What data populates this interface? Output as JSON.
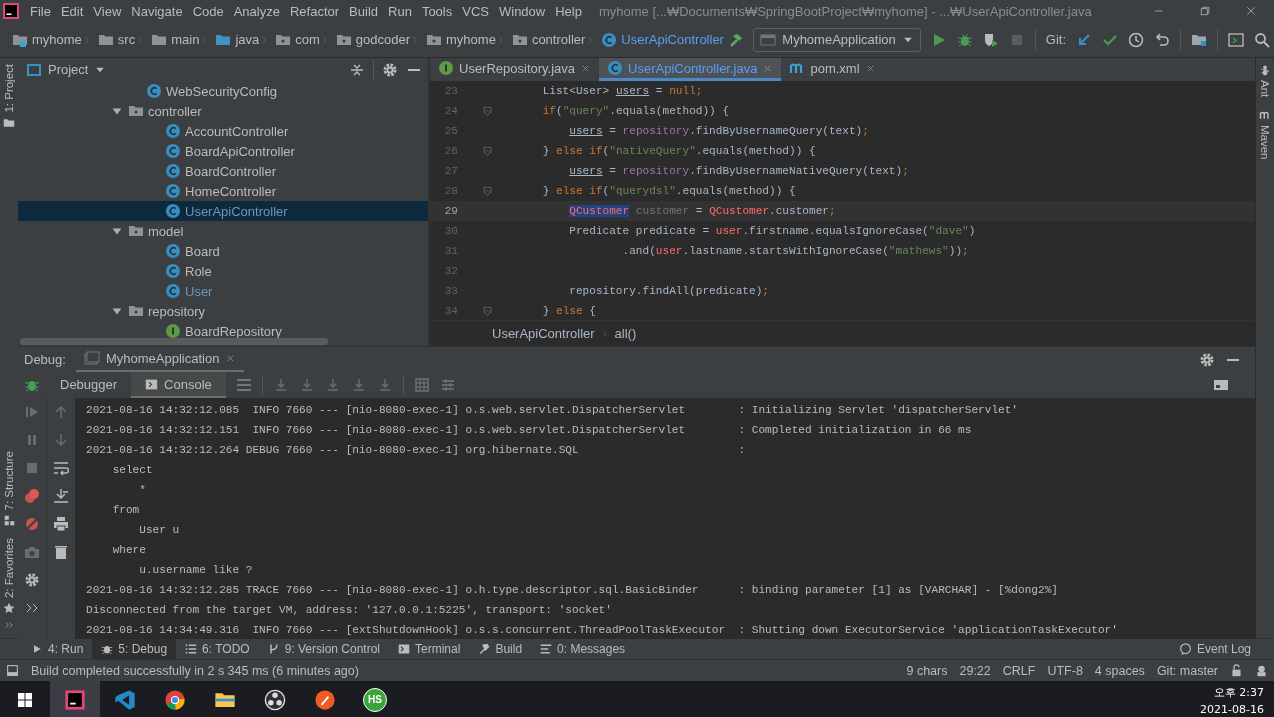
{
  "window": {
    "title": "myhome [...₩Documents₩SpringBootProject₩myhome] - ...₩UserApiController.java"
  },
  "menu": [
    "File",
    "Edit",
    "View",
    "Navigate",
    "Code",
    "Analyze",
    "Refactor",
    "Build",
    "Run",
    "Tools",
    "VCS",
    "Window",
    "Help"
  ],
  "breadcrumb": [
    {
      "label": "myhome",
      "kind": "module"
    },
    {
      "label": "src",
      "kind": "folder"
    },
    {
      "label": "main",
      "kind": "folder"
    },
    {
      "label": "java",
      "kind": "source"
    },
    {
      "label": "com",
      "kind": "package"
    },
    {
      "label": "godcoder",
      "kind": "package"
    },
    {
      "label": "myhome",
      "kind": "package"
    },
    {
      "label": "controller",
      "kind": "package"
    },
    {
      "label": "UserApiController",
      "kind": "class"
    }
  ],
  "run_config": {
    "label": "MyhomeApplication"
  },
  "git_label": "Git:",
  "side_tools": {
    "left_top": [
      {
        "label": "1: Project",
        "kind": "folder"
      }
    ],
    "left_bottom": [
      {
        "label": "7: Structure",
        "kind": "structure"
      },
      {
        "label": "2: Favorites",
        "kind": "star"
      }
    ],
    "right": [
      {
        "label": "Ant",
        "kind": "ant"
      },
      {
        "label": "Maven",
        "kind": "maven"
      }
    ]
  },
  "project": {
    "title": "Project",
    "tree": [
      {
        "label": "WebSecurityConfig",
        "kind": "class",
        "modified": false,
        "selected": false
      },
      {
        "label": "controller",
        "kind": "package",
        "expanded": true,
        "selected": false,
        "children": [
          {
            "label": "AccountController",
            "kind": "class",
            "modified": false,
            "selected": false
          },
          {
            "label": "BoardApiController",
            "kind": "class",
            "modified": false,
            "selected": false
          },
          {
            "label": "BoardController",
            "kind": "class",
            "modified": false,
            "selected": false
          },
          {
            "label": "HomeController",
            "kind": "class",
            "modified": false,
            "selected": false
          },
          {
            "label": "UserApiController",
            "kind": "class",
            "modified": true,
            "selected": true
          }
        ]
      },
      {
        "label": "model",
        "kind": "package",
        "expanded": true,
        "selected": false,
        "children": [
          {
            "label": "Board",
            "kind": "class",
            "modified": false,
            "selected": false
          },
          {
            "label": "Role",
            "kind": "class",
            "modified": false,
            "selected": false
          },
          {
            "label": "User",
            "kind": "class",
            "modified": true,
            "selected": false
          }
        ]
      },
      {
        "label": "repository",
        "kind": "package",
        "expanded": true,
        "selected": false,
        "children": [
          {
            "label": "BoardRepository",
            "kind": "interface",
            "modified": false,
            "selected": false
          }
        ]
      }
    ]
  },
  "editor": {
    "tabs": [
      {
        "label": "UserRepository.java",
        "kind": "interface",
        "selected": false
      },
      {
        "label": "UserApiController.java",
        "kind": "class",
        "selected": true
      },
      {
        "label": "pom.xml",
        "kind": "maven",
        "selected": false
      }
    ],
    "lines": [
      {
        "number": "23",
        "current": false,
        "fold": false,
        "segments": [
          {
            "text": "    List<User> ",
            "kind": "plain"
          },
          {
            "text": "users",
            "kind": "underline"
          },
          {
            "text": " = ",
            "kind": "plain"
          },
          {
            "text": "null;",
            "kind": "keyword"
          }
        ]
      },
      {
        "number": "24",
        "current": false,
        "fold": true,
        "segments": [
          {
            "text": "    if",
            "kind": "keyword"
          },
          {
            "text": "(",
            "kind": "plain"
          },
          {
            "text": "\"query\"",
            "kind": "string"
          },
          {
            "text": ".equals(method)) {",
            "kind": "plain"
          }
        ]
      },
      {
        "number": "25",
        "current": false,
        "fold": false,
        "segments": [
          {
            "text": "        users",
            "kind": "underline"
          },
          {
            "text": " = ",
            "kind": "plain"
          },
          {
            "text": "repository",
            "kind": "field"
          },
          {
            "text": ".findByUsernameQuery(text)",
            "kind": "plain"
          },
          {
            "text": ";",
            "kind": "keyword"
          }
        ]
      },
      {
        "number": "26",
        "current": false,
        "fold": true,
        "segments": [
          {
            "text": "    } ",
            "kind": "plain"
          },
          {
            "text": "else if",
            "kind": "keyword"
          },
          {
            "text": "(",
            "kind": "plain"
          },
          {
            "text": "\"nativeQuery\"",
            "kind": "string"
          },
          {
            "text": ".equals(method)) {",
            "kind": "plain"
          }
        ]
      },
      {
        "number": "27",
        "current": false,
        "fold": false,
        "segments": [
          {
            "text": "        users",
            "kind": "underline"
          },
          {
            "text": " = ",
            "kind": "plain"
          },
          {
            "text": "repository",
            "kind": "field"
          },
          {
            "text": ".findByUsernameNativeQuery(text)",
            "kind": "plain"
          },
          {
            "text": ";",
            "kind": "keyword"
          }
        ]
      },
      {
        "number": "28",
        "current": false,
        "fold": true,
        "segments": [
          {
            "text": "    } ",
            "kind": "plain"
          },
          {
            "text": "else if",
            "kind": "keyword"
          },
          {
            "text": "(",
            "kind": "plain"
          },
          {
            "text": "\"querydsl\"",
            "kind": "string"
          },
          {
            "text": ".equals(method)) {",
            "kind": "plain"
          }
        ]
      },
      {
        "number": "29",
        "current": true,
        "fold": false,
        "segments": [
          {
            "text": "        QCustomer",
            "kind": "selected-error"
          },
          {
            "text": " customer",
            "kind": "unused"
          },
          {
            "text": " = ",
            "kind": "plain"
          },
          {
            "text": "QCustomer",
            "kind": "error"
          },
          {
            "text": ".customer",
            "kind": "plain"
          },
          {
            "text": ";",
            "kind": "keyword"
          }
        ]
      },
      {
        "number": "30",
        "current": false,
        "fold": false,
        "segments": [
          {
            "text": "        Predicate predicate = ",
            "kind": "plain"
          },
          {
            "text": "user",
            "kind": "error"
          },
          {
            "text": ".firstname.equalsIgnoreCase(",
            "kind": "plain"
          },
          {
            "text": "\"dave\"",
            "kind": "string"
          },
          {
            "text": ")",
            "kind": "plain"
          }
        ]
      },
      {
        "number": "31",
        "current": false,
        "fold": false,
        "segments": [
          {
            "text": "                .and(",
            "kind": "plain"
          },
          {
            "text": "user",
            "kind": "error"
          },
          {
            "text": ".lastname.startsWithIgnoreCase(",
            "kind": "plain"
          },
          {
            "text": "\"mathews\"",
            "kind": "string"
          },
          {
            "text": "))",
            "kind": "plain"
          },
          {
            "text": ";",
            "kind": "keyword"
          }
        ]
      },
      {
        "number": "32",
        "current": false,
        "fold": false
      },
      {
        "number": "33",
        "current": false,
        "fold": false,
        "segments": [
          {
            "text": "        repository.findAll(predicate)",
            "kind": "plain"
          },
          {
            "text": ";",
            "kind": "keyword"
          }
        ]
      },
      {
        "number": "34",
        "current": false,
        "fold": true,
        "segments": [
          {
            "text": "    } ",
            "kind": "plain"
          },
          {
            "text": "else",
            "kind": "keyword"
          },
          {
            "text": " {",
            "kind": "plain"
          }
        ]
      }
    ],
    "breadcrumb": [
      "UserApiController",
      "all()"
    ]
  },
  "debug": {
    "label": "Debug:",
    "session": "MyhomeApplication",
    "tabs": [
      {
        "label": "Debugger",
        "selected": false
      },
      {
        "label": "Console",
        "selected": true
      }
    ],
    "console": [
      "2021-08-16 14:32:12.085  INFO 7660 --- [nio-8080-exec-1] o.s.web.servlet.DispatcherServlet        : Initializing Servlet 'dispatcherServlet'",
      "2021-08-16 14:32:12.151  INFO 7660 --- [nio-8080-exec-1] o.s.web.servlet.DispatcherServlet        : Completed initialization in 66 ms",
      "2021-08-16 14:32:12.264 DEBUG 7660 --- [nio-8080-exec-1] org.hibernate.SQL                        :",
      "    select",
      "        *",
      "    from",
      "        User u",
      "    where",
      "        u.username like ?",
      "2021-08-16 14:32:12.285 TRACE 7660 --- [nio-8080-exec-1] o.h.type.descriptor.sql.BasicBinder      : binding parameter [1] as [VARCHAR] - [%dong2%]",
      "Disconnected from the target VM, address: '127.0.0.1:5225', transport: 'socket'",
      "2021-08-16 14:34:49.316  INFO 7660 --- [extShutdownHook] o.s.s.concurrent.ThreadPoolTaskExecutor  : Shutting down ExecutorService 'applicationTaskExecutor'"
    ]
  },
  "tool_windows": [
    {
      "label": "4: Run",
      "kind": "run",
      "selected": false
    },
    {
      "label": "5: Debug",
      "kind": "debug",
      "selected": true
    },
    {
      "label": "6: TODO",
      "kind": "todo",
      "selected": false
    },
    {
      "label": "9: Version Control",
      "kind": "vcs",
      "selected": false
    },
    {
      "label": "Terminal",
      "kind": "terminal",
      "selected": false
    },
    {
      "label": "Build",
      "kind": "build",
      "selected": false
    },
    {
      "label": "0: Messages",
      "kind": "messages",
      "selected": false
    }
  ],
  "event_log": "Event Log",
  "status": {
    "message": "Build completed successfully in 2 s 345 ms (6 minutes ago)",
    "items": [
      "9 chars",
      "29:22",
      "CRLF",
      "UTF-8",
      "4 spaces",
      "Git: master"
    ]
  },
  "taskbar": {
    "apps": [
      {
        "kind": "intellij",
        "selected": true
      },
      {
        "kind": "vscode",
        "selected": false
      },
      {
        "kind": "chrome",
        "selected": false
      },
      {
        "kind": "files",
        "selected": false
      },
      {
        "kind": "obs",
        "selected": false
      },
      {
        "kind": "orange",
        "selected": false
      },
      {
        "kind": "badge",
        "label": "HS",
        "selected": false
      }
    ],
    "time": "오후 2:37",
    "date": "2021-08-16"
  }
}
